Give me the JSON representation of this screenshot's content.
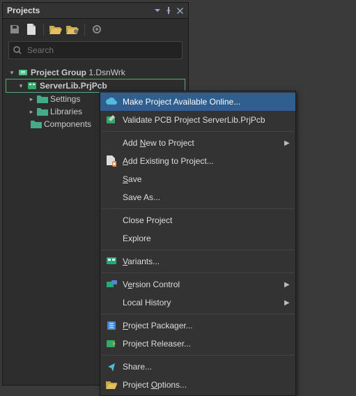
{
  "panel": {
    "title": "Projects",
    "search_placeholder": "Search"
  },
  "tree": {
    "group_prefix": "Project Group ",
    "group_name": "1.DsnWrk",
    "project_name": "ServerLib.PrjPcb",
    "settings": "Settings",
    "libraries": "Libraries",
    "components": "Components"
  },
  "menu": {
    "make_online": "Make Project Available Online...",
    "validate_prefix": "Validate PCB Project ",
    "validate_name": "ServerLib.PrjPcb",
    "add_new_pre": "Add ",
    "add_new_mn": "N",
    "add_new_post": "ew to Project",
    "add_existing_mn": "A",
    "add_existing_post": "dd Existing to Project...",
    "save_mn": "S",
    "save_post": "ave",
    "save_as": "Save As...",
    "close_project": "Close Project",
    "explore": "Explore",
    "variants_mn": "V",
    "variants_post": "ariants...",
    "version_pre": "V",
    "version_mn": "e",
    "version_post": "rsion Control",
    "local_history": "Local History",
    "packager_mn": "P",
    "packager_post": "roject Packager...",
    "releaser": "Project Releaser...",
    "share": "Share...",
    "options_pre": "Project ",
    "options_mn": "O",
    "options_post": "ptions..."
  }
}
